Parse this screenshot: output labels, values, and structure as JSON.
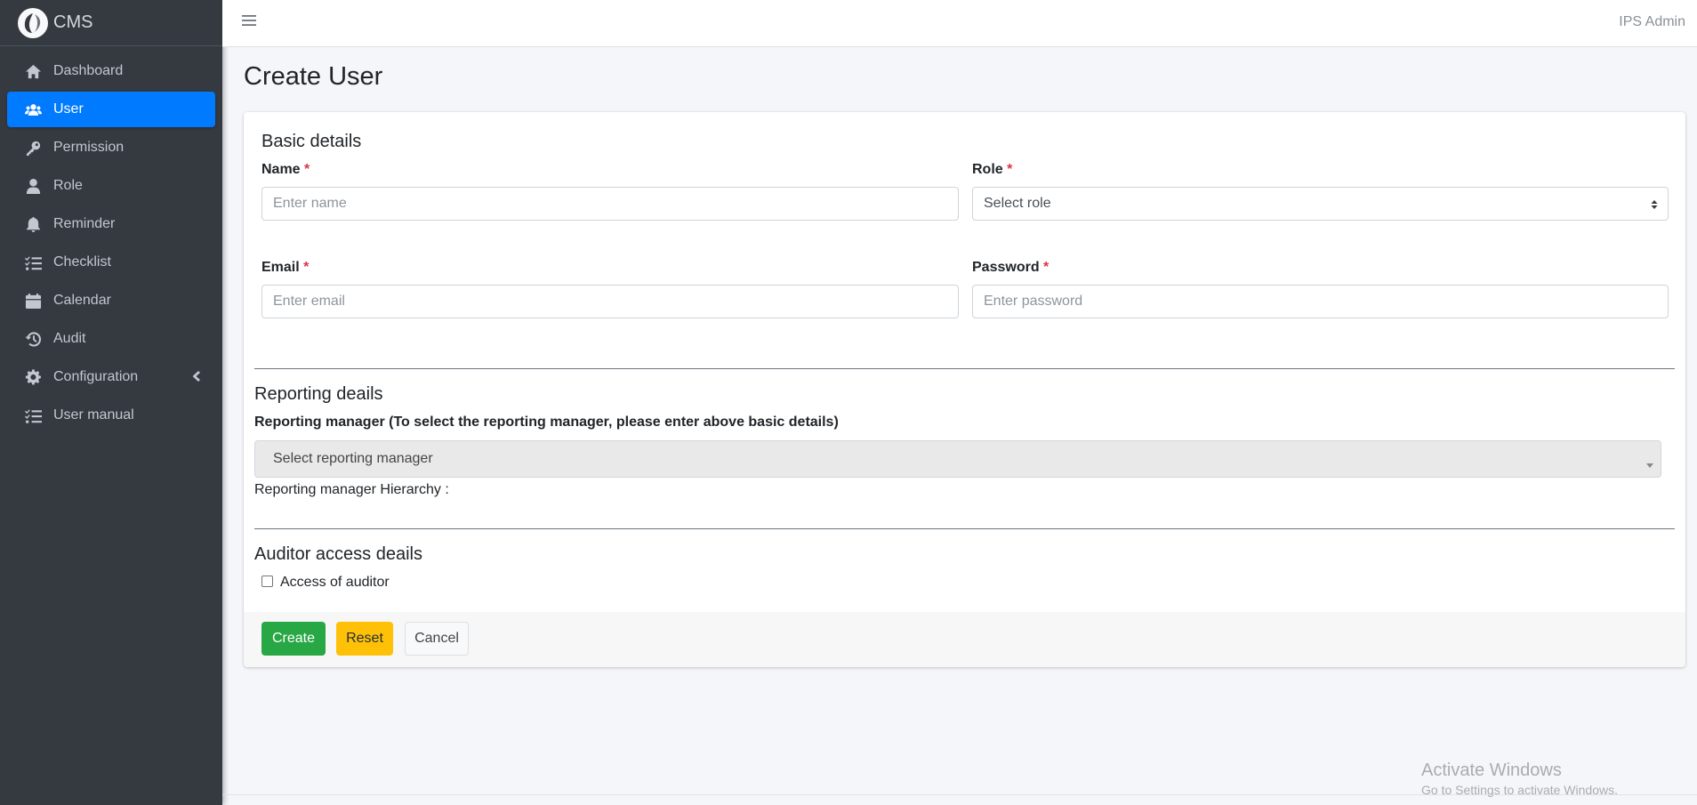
{
  "brand": {
    "name": "CMS",
    "logo_icon": "feather-logo-icon"
  },
  "sidebar": {
    "items": [
      {
        "label": "Dashboard",
        "icon": "home-icon",
        "active": false
      },
      {
        "label": "User",
        "icon": "users-icon",
        "active": true
      },
      {
        "label": "Permission",
        "icon": "key-icon",
        "active": false
      },
      {
        "label": "Role",
        "icon": "user-icon",
        "active": false
      },
      {
        "label": "Reminder",
        "icon": "bell-icon",
        "active": false
      },
      {
        "label": "Checklist",
        "icon": "list-check-icon",
        "active": false
      },
      {
        "label": "Calendar",
        "icon": "calendar-icon",
        "active": false
      },
      {
        "label": "Audit",
        "icon": "history-icon",
        "active": false
      },
      {
        "label": "Configuration",
        "icon": "gear-icon",
        "active": false,
        "expandable": true
      },
      {
        "label": "User manual",
        "icon": "list-icon",
        "active": false
      }
    ]
  },
  "topbar": {
    "menu_icon": "hamburger-icon",
    "user_name": "IPS Admin"
  },
  "page": {
    "title": "Create User"
  },
  "form": {
    "basic": {
      "title": "Basic details",
      "name_label": "Name",
      "name_placeholder": "Enter name",
      "role_label": "Role",
      "role_placeholder": "Select role",
      "email_label": "Email",
      "email_placeholder": "Enter email",
      "password_label": "Password",
      "password_placeholder": "Enter password",
      "required_mark": "*"
    },
    "reporting": {
      "title": "Reporting deails",
      "manager_label": "Reporting manager (To select the reporting manager, please enter above basic details)",
      "manager_placeholder": "Select reporting manager",
      "hierarchy_label": "Reporting manager Hierarchy :"
    },
    "auditor": {
      "title": "Auditor access deails",
      "checkbox_label": "Access of auditor",
      "checked": false
    },
    "buttons": {
      "create": "Create",
      "reset": "Reset",
      "cancel": "Cancel"
    }
  },
  "watermark": {
    "title": "Activate Windows",
    "subtitle": "Go to Settings to activate Windows."
  },
  "colors": {
    "sidebar_bg": "#343a40",
    "active_item": "#007bff",
    "create": "#28a745",
    "reset": "#ffc107",
    "required": "#dc3545"
  }
}
